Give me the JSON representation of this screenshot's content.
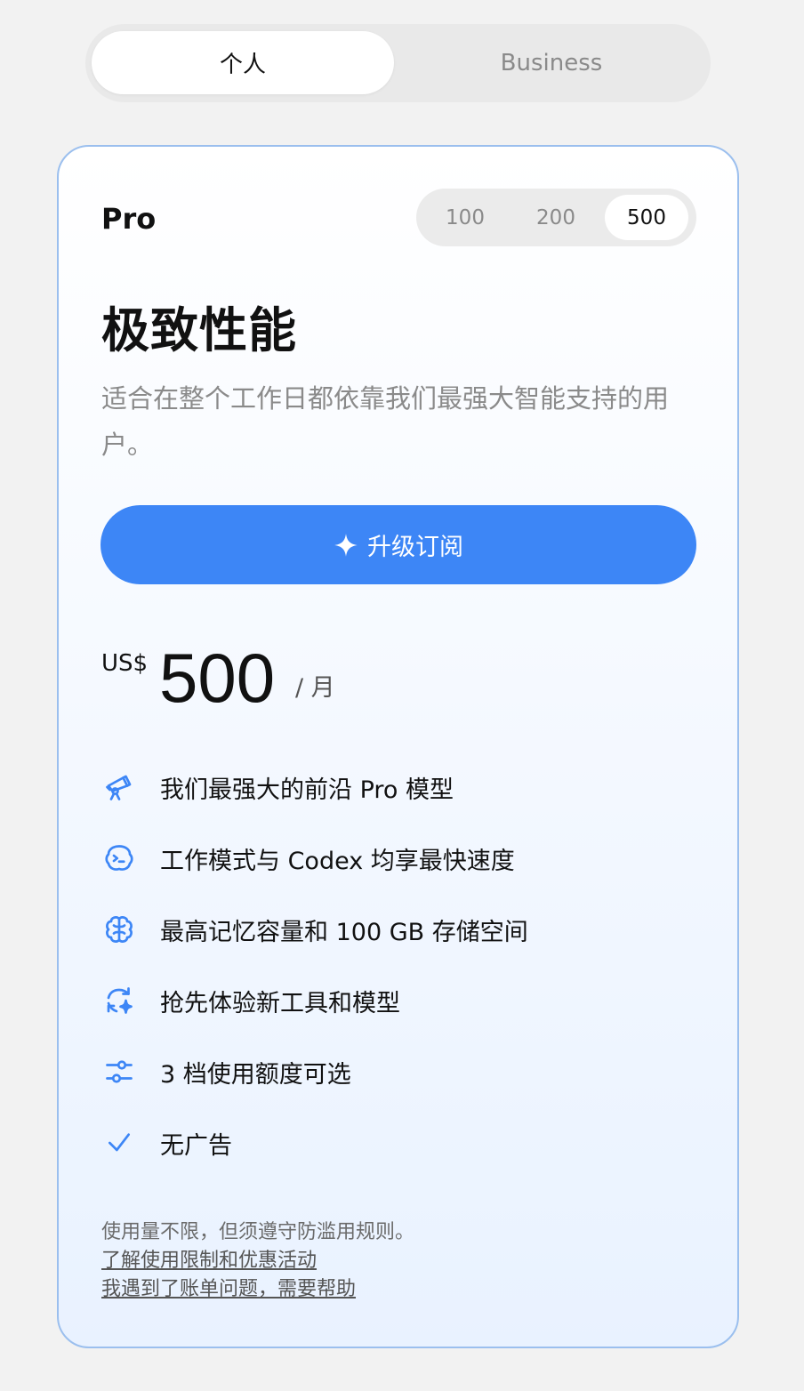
{
  "tabs": {
    "personal": "个人",
    "business": "Business"
  },
  "plan": {
    "name": "Pro",
    "tiers": [
      "100",
      "200",
      "500"
    ],
    "selected_tier": "500",
    "headline": "极致性能",
    "description": "适合在整个工作日都依靠我们最强大智能支持的用户。",
    "cta": "升级订阅",
    "currency": "US$",
    "price": "500",
    "period": "/ 月",
    "features": [
      {
        "icon": "telescope-icon",
        "text": "我们最强大的前沿 Pro 模型"
      },
      {
        "icon": "terminal-bubble-icon",
        "text": "工作模式与 Codex 均享最快速度"
      },
      {
        "icon": "brain-icon",
        "text": "最高记忆容量和 100 GB 存储空间"
      },
      {
        "icon": "refresh-sparkle-icon",
        "text": "抢先体验新工具和模型"
      },
      {
        "icon": "sliders-icon",
        "text": "3 档使用额度可选"
      },
      {
        "icon": "check-icon",
        "text": "无广告"
      }
    ],
    "note": "使用量不限，但须遵守防滥用规则。",
    "links": {
      "limits": "了解使用限制和优惠活动",
      "billing": "我遇到了账单问题，需要帮助"
    }
  },
  "colors": {
    "accent": "#3d86f6",
    "card_border": "#9bbfee"
  }
}
